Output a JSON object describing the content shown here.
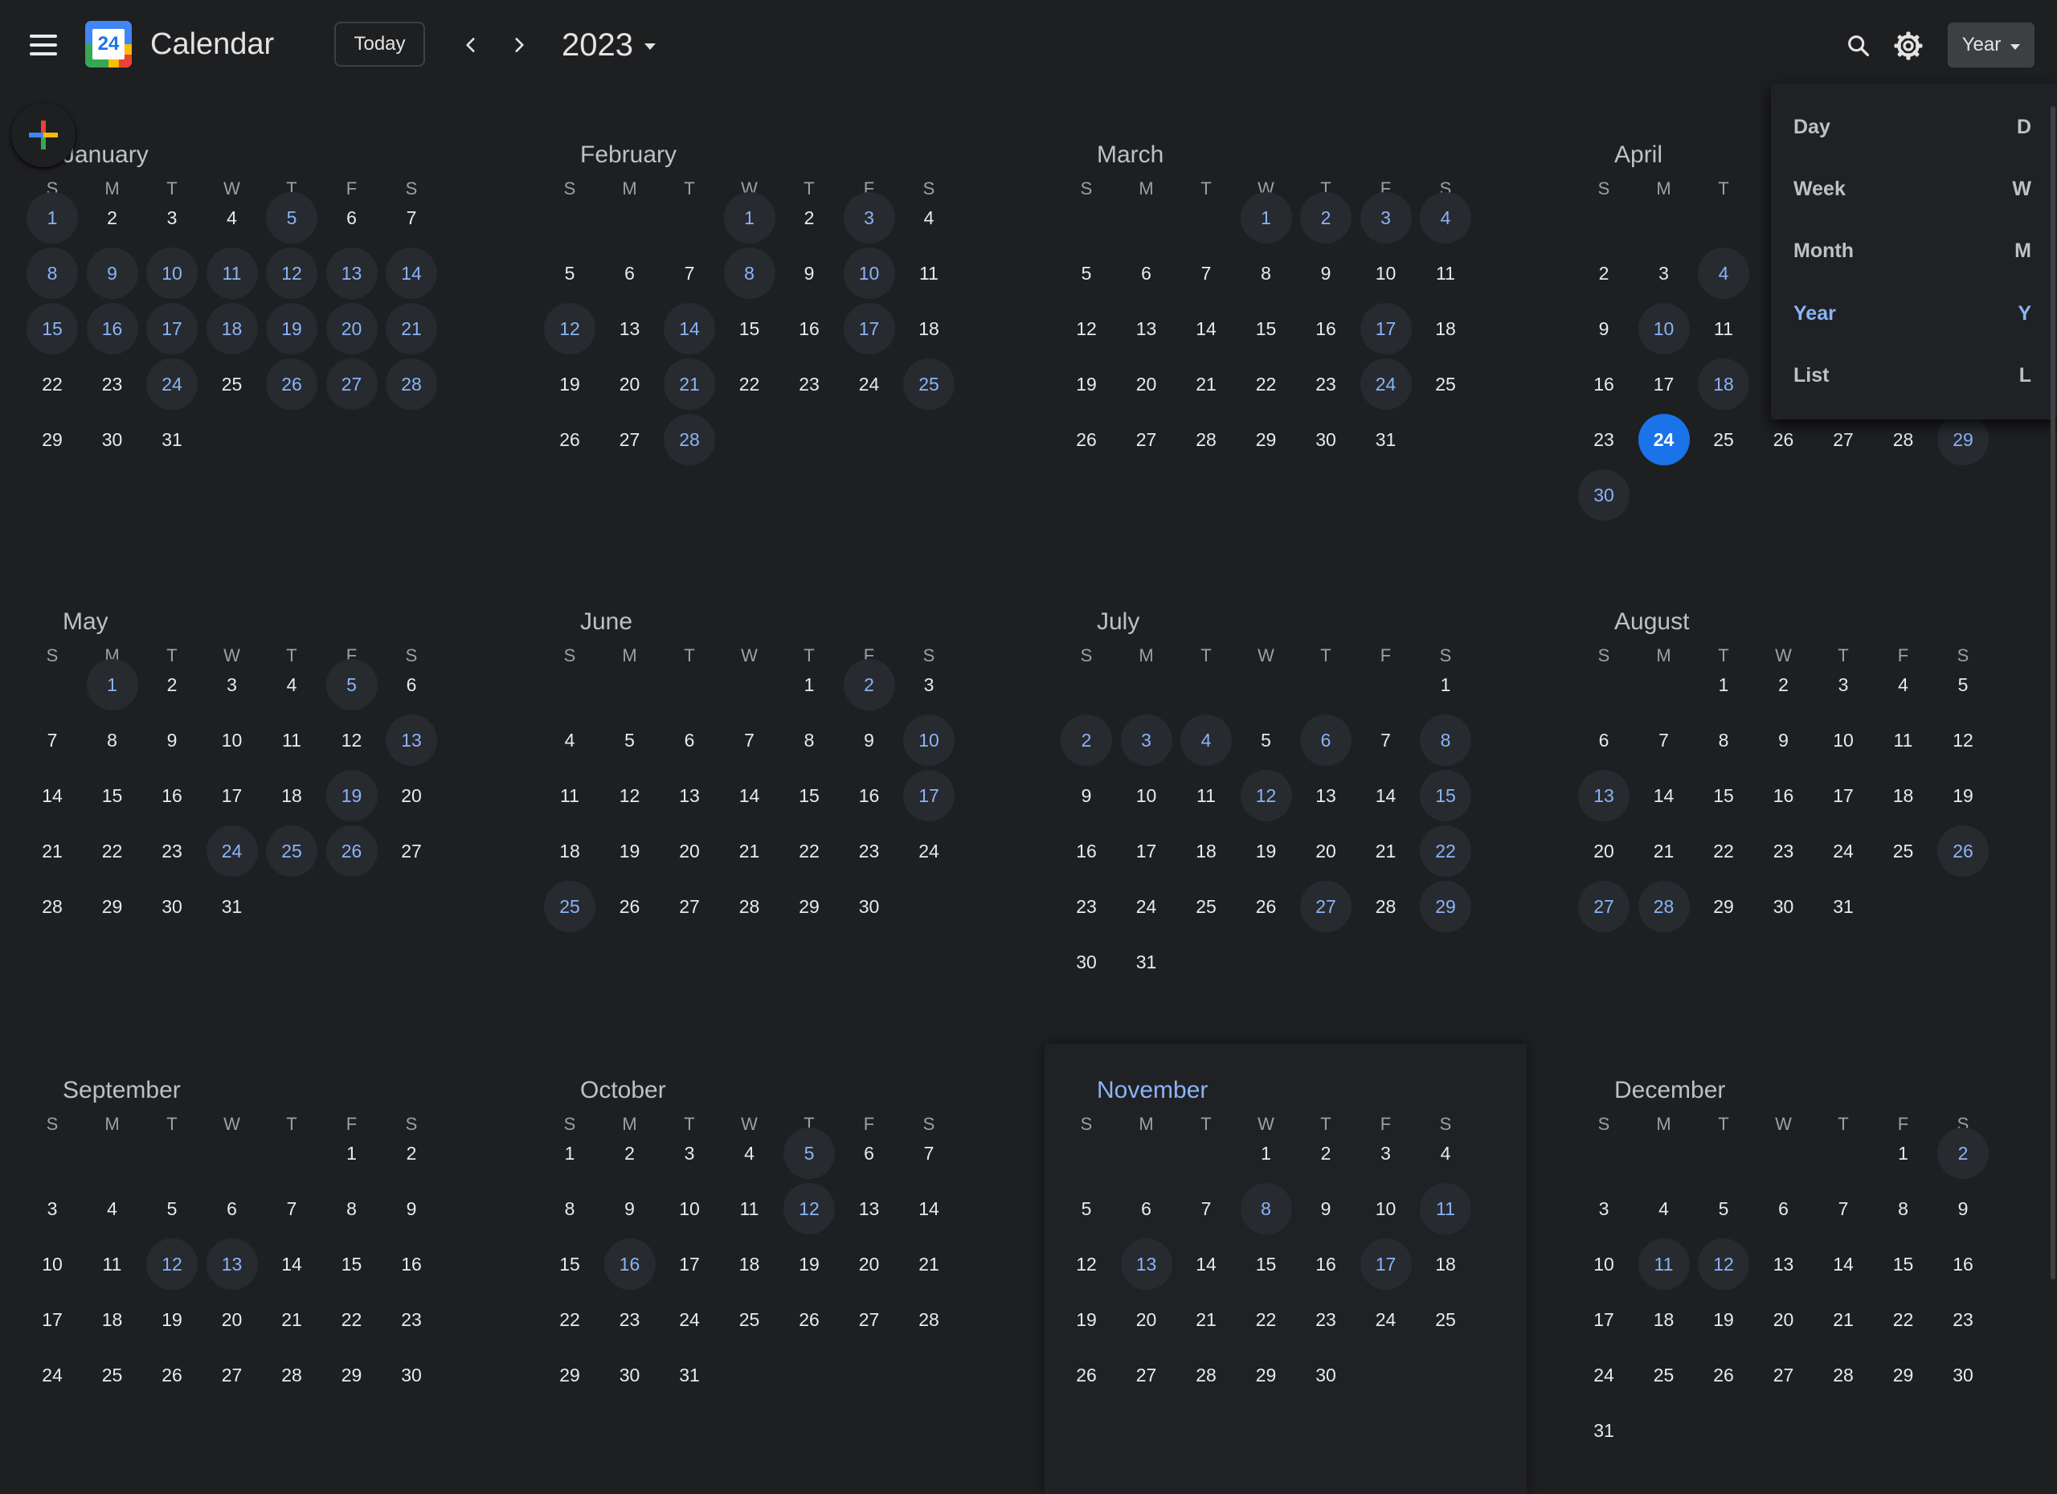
{
  "header": {
    "app_name": "Calendar",
    "logo_text": "24",
    "today_label": "Today",
    "year_label": "2023",
    "view_label": "Year"
  },
  "icons": [
    "menu-icon",
    "calendar-logo",
    "chevron-left-icon",
    "chevron-right-icon",
    "search-icon",
    "gear-icon",
    "create-plus-icon"
  ],
  "colors": {
    "background": "#1e1f21",
    "accent": "#8ab4f8",
    "today": "#1a73e8",
    "event_circle": "#272a2f"
  },
  "today": {
    "month": 3,
    "day": 24
  },
  "weekdays": [
    "S",
    "M",
    "T",
    "W",
    "T",
    "F",
    "S"
  ],
  "months": [
    {
      "name": "January",
      "start": 0,
      "days": 31,
      "events": [
        1,
        5,
        8,
        9,
        10,
        11,
        12,
        13,
        14,
        15,
        16,
        17,
        18,
        19,
        20,
        21,
        24,
        26,
        27,
        28
      ]
    },
    {
      "name": "February",
      "start": 3,
      "days": 28,
      "events": [
        1,
        3,
        8,
        10,
        12,
        14,
        17,
        21,
        25,
        28
      ]
    },
    {
      "name": "March",
      "start": 3,
      "days": 31,
      "events": [
        1,
        2,
        3,
        4,
        17,
        24
      ]
    },
    {
      "name": "April",
      "start": 6,
      "days": 30,
      "events": [
        4,
        10,
        18,
        29,
        30
      ]
    },
    {
      "name": "May",
      "start": 1,
      "days": 31,
      "events": [
        1,
        5,
        13,
        19,
        24,
        25,
        26
      ]
    },
    {
      "name": "June",
      "start": 4,
      "days": 30,
      "events": [
        2,
        10,
        17,
        25
      ]
    },
    {
      "name": "July",
      "start": 6,
      "days": 31,
      "events": [
        2,
        3,
        4,
        6,
        8,
        12,
        15,
        22,
        27,
        29
      ]
    },
    {
      "name": "August",
      "start": 2,
      "days": 31,
      "events": [
        13,
        26,
        27,
        28
      ]
    },
    {
      "name": "September",
      "start": 5,
      "days": 30,
      "events": [
        12,
        13
      ]
    },
    {
      "name": "October",
      "start": 0,
      "days": 31,
      "events": [
        5,
        12,
        16
      ]
    },
    {
      "name": "November",
      "start": 3,
      "days": 30,
      "events": [
        8,
        11,
        13,
        17
      ]
    },
    {
      "name": "December",
      "start": 5,
      "days": 31,
      "events": [
        2,
        11,
        12
      ]
    }
  ],
  "highlighted_month": 10,
  "view_menu": {
    "items": [
      {
        "label": "Day",
        "key": "D",
        "selected": false
      },
      {
        "label": "Week",
        "key": "W",
        "selected": false
      },
      {
        "label": "Month",
        "key": "M",
        "selected": false
      },
      {
        "label": "Year",
        "key": "Y",
        "selected": true
      },
      {
        "label": "List",
        "key": "L",
        "selected": false
      }
    ]
  }
}
